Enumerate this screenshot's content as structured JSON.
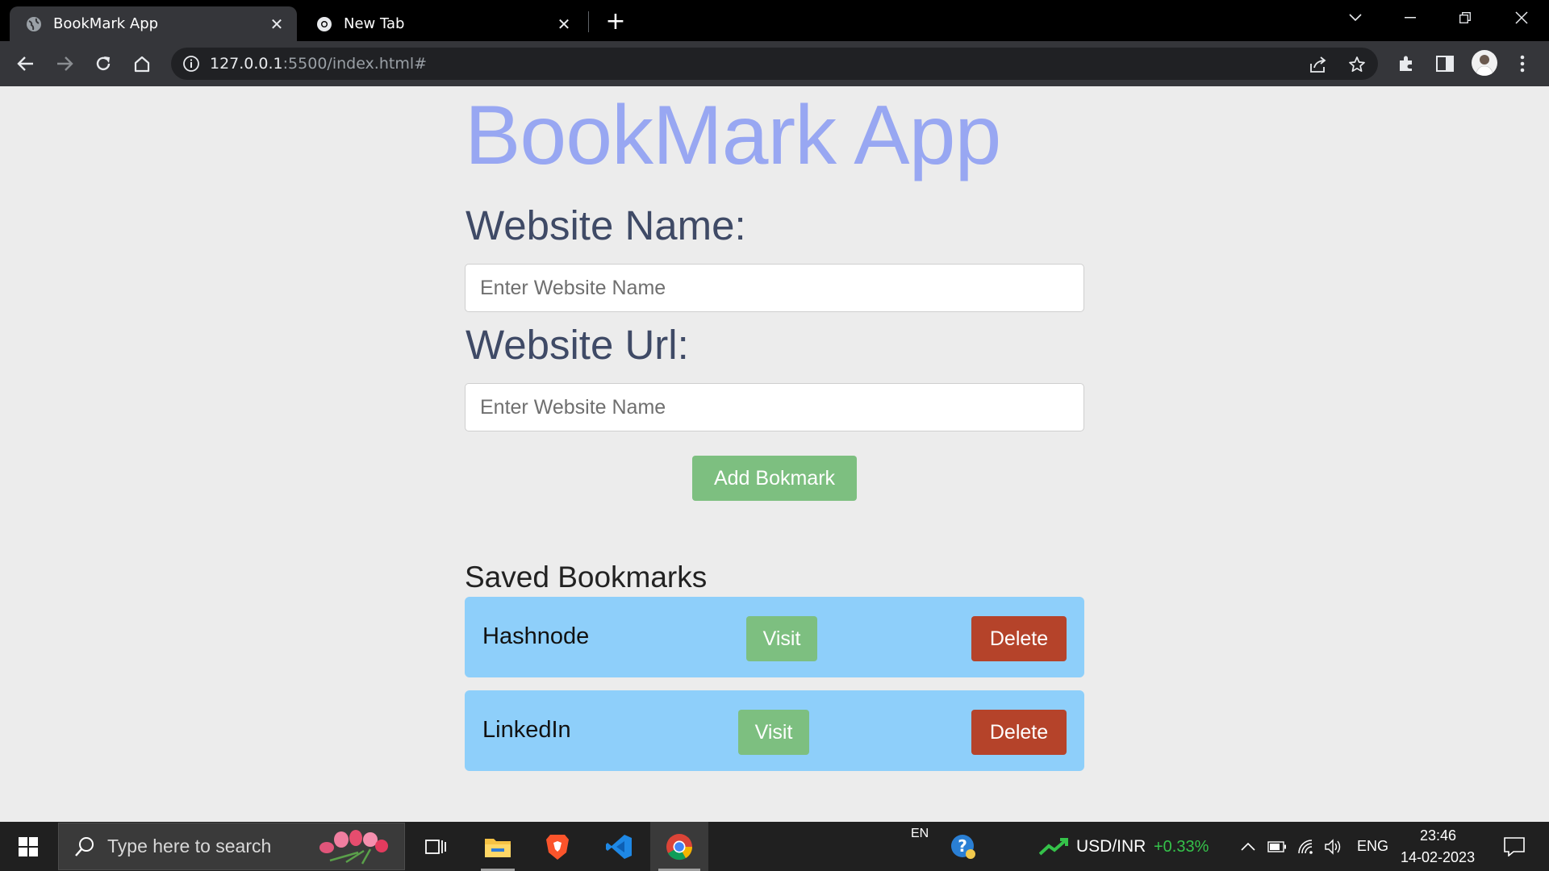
{
  "browser": {
    "tabs": [
      {
        "title": "BookMark App",
        "active": true
      },
      {
        "title": "New Tab",
        "active": false
      }
    ],
    "url_host": "127.0.0.1",
    "url_rest": ":5500/index.html#"
  },
  "app": {
    "title": "BookMark App",
    "name_label": "Website Name:",
    "name_placeholder": "Enter Website Name",
    "url_label": "Website Url:",
    "url_placeholder": "Enter Website Name",
    "add_button": "Add Bokmark",
    "saved_title": "Saved Bookmarks",
    "bookmarks": [
      {
        "name": "Hashnode",
        "visit": "Visit",
        "delete": "Delete"
      },
      {
        "name": "LinkedIn",
        "visit": "Visit",
        "delete": "Delete"
      }
    ]
  },
  "taskbar": {
    "search_placeholder": "Type here to search",
    "lang_small": "EN",
    "ticker": "USD/INR",
    "ticker_change": "+0.33%",
    "input_lang": "ENG",
    "time": "23:46",
    "date": "14-02-2023"
  },
  "colors": {
    "title": "#98a7f2",
    "card": "#8ecffa",
    "visit": "#7dbf80",
    "delete": "#b5432a",
    "ticker_up": "#35c24a"
  }
}
